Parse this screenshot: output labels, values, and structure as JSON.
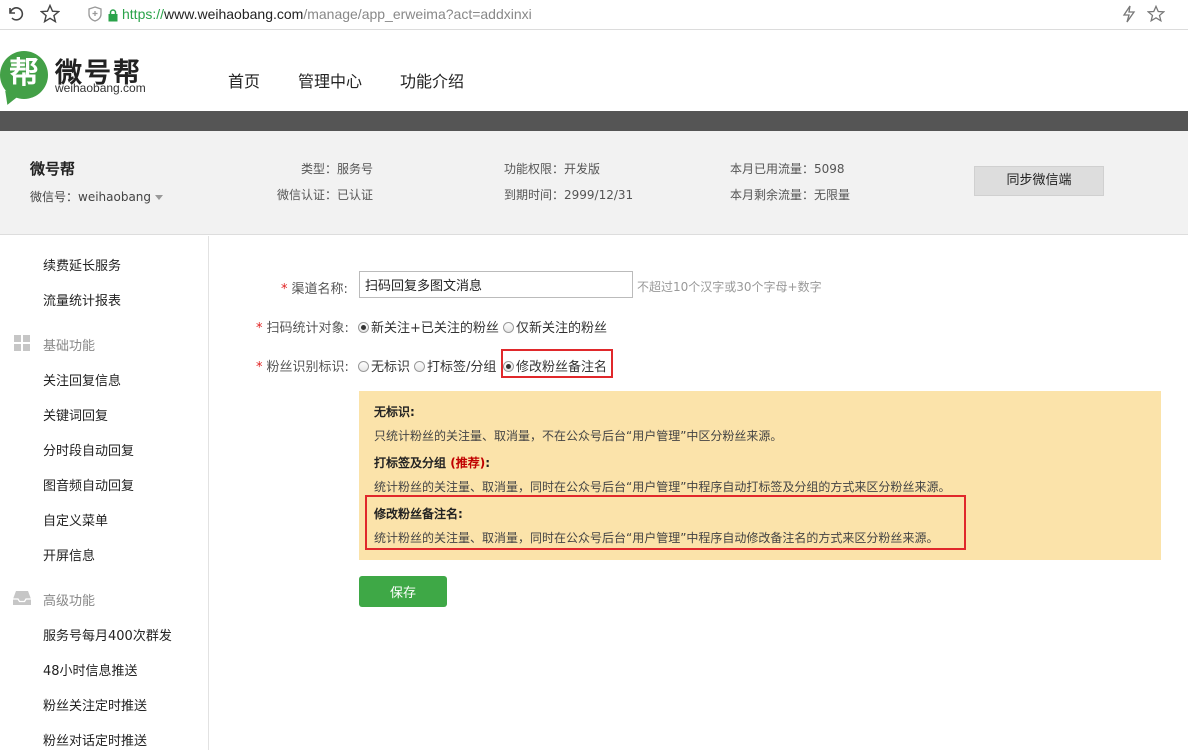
{
  "browser": {
    "back_icon": "back-arrow-icon",
    "star_icon": "star-outline-icon",
    "url_scheme": "https://",
    "url_host": "www.weihaobang.com",
    "url_path": "/manage/app_erweima?act=addxinxi"
  },
  "site": {
    "logo_char": "帮",
    "logo_name": "微号帮",
    "logo_domain": "weihaobang.com",
    "nav": [
      "首页",
      "管理中心",
      "功能介绍"
    ],
    "brand_color": "#43a047"
  },
  "account": {
    "name": "微号帮",
    "wechat_id": "微信号：weihaobang",
    "type": "类型：服务号",
    "verified": "微信认证：已认证",
    "permission": "功能权限：开发版",
    "expire": "到期时间：2999/12/31",
    "traffic_used": "本月已用流量：5098",
    "traffic_left": "本月剩余流量：无限量",
    "sync_label": "同步微信端"
  },
  "sidebar": {
    "items_top": [
      "续费延长服务",
      "流量统计报表"
    ],
    "group_basic": "基础功能",
    "items_basic": [
      "关注回复信息",
      "关键词回复",
      "分时段自动回复",
      "图音频自动回复",
      "自定义菜单",
      "开屏信息"
    ],
    "group_advanced": "高级功能",
    "items_advanced": [
      "服务号每月400次群发",
      "48小时信息推送",
      "粉丝关注定时推送",
      "粉丝对话定时推送"
    ]
  },
  "form": {
    "channel_label": "渠道名称:",
    "channel_value": "扫码回复多图文消息",
    "channel_hint": "不超过10个汉字或30个字母+数字",
    "target_label": "扫码统计对象:",
    "target_options": [
      "新关注+已关注的粉丝",
      "仅新关注的粉丝"
    ],
    "target_selected": 0,
    "identify_label": "粉丝识别标识:",
    "identify_options": [
      "无标识",
      "打标签/分组",
      "修改粉丝备注名"
    ],
    "identify_selected": 2,
    "required_mark": "*",
    "save_label": "保存"
  },
  "notice": {
    "none_title": "无标识:",
    "none_desc": "只统计粉丝的关注量、取消量，不在公众号后台“用户管理”中区分粉丝来源。",
    "tag_title": "打标签及分组",
    "tag_recommend": "(推荐)",
    "tag_colon": ":",
    "tag_desc": "统计粉丝的关注量、取消量，同时在公众号后台“用户管理”中程序自动打标签及分组的方式来区分粉丝来源。",
    "remark_title": "修改粉丝备注名:",
    "remark_desc": "统计粉丝的关注量、取消量，同时在公众号后台“用户管理”中程序自动修改备注名的方式来区分粉丝来源。",
    "bg_color": "#fbe3aa",
    "highlight_color": "#e0282b"
  }
}
